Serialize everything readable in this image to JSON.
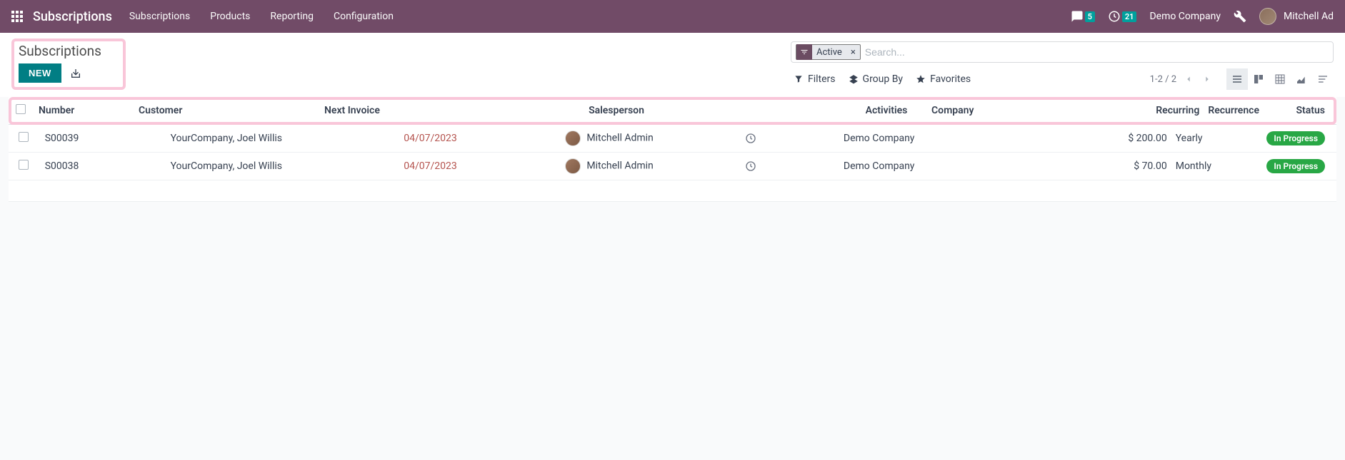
{
  "navbar": {
    "brand": "Subscriptions",
    "menu": [
      "Subscriptions",
      "Products",
      "Reporting",
      "Configuration"
    ],
    "messages_badge": "5",
    "activities_badge": "21",
    "company": "Demo Company",
    "user_name": "Mitchell Ad"
  },
  "control_panel": {
    "title": "Subscriptions",
    "new_button": "NEW",
    "search": {
      "chip_label": "Active",
      "placeholder": "Search..."
    },
    "filters_label": "Filters",
    "groupby_label": "Group By",
    "favorites_label": "Favorites",
    "pager": "1-2 / 2"
  },
  "columns": {
    "number": "Number",
    "customer": "Customer",
    "next_invoice": "Next Invoice",
    "salesperson": "Salesperson",
    "activities": "Activities",
    "company": "Company",
    "recurring": "Recurring",
    "recurrence": "Recurrence",
    "status": "Status"
  },
  "rows": [
    {
      "number": "S00039",
      "customer": "YourCompany, Joel Willis",
      "next_invoice": "04/07/2023",
      "salesperson": "Mitchell Admin",
      "company": "Demo Company",
      "recurring": "$ 200.00",
      "recurrence": "Yearly",
      "status": "In Progress"
    },
    {
      "number": "S00038",
      "customer": "YourCompany, Joel Willis",
      "next_invoice": "04/07/2023",
      "salesperson": "Mitchell Admin",
      "company": "Demo Company",
      "recurring": "$ 70.00",
      "recurrence": "Monthly",
      "status": "In Progress"
    }
  ]
}
